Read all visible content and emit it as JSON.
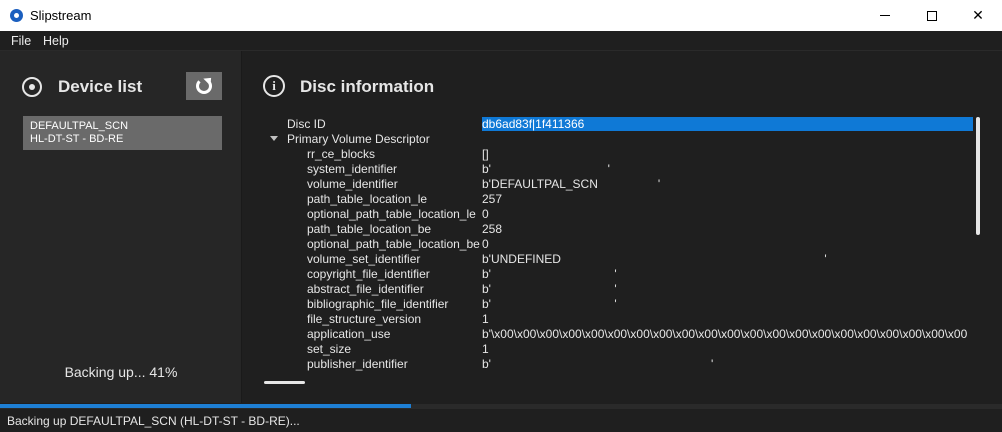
{
  "window": {
    "title": "Slipstream",
    "minimize_symbol": "",
    "maximize_symbol": "",
    "close_symbol": "✕"
  },
  "menu": {
    "items": [
      "File",
      "Help"
    ]
  },
  "device_panel": {
    "title": "Device list",
    "icon": "disc-icon",
    "refresh_icon": "refresh-icon",
    "devices": [
      {
        "name": "DEFAULTPAL_SCN",
        "drive": "HL-DT-ST - BD-RE"
      }
    ],
    "status": "Backing up... 41%"
  },
  "disc_panel": {
    "title": "Disc information",
    "icon": "info-icon",
    "rows": [
      {
        "key": "Disc ID",
        "value": "db6ad83f|1f411366",
        "indent": 0,
        "selected": true
      },
      {
        "key": "Primary Volume Descriptor",
        "value": "",
        "indent": 0,
        "expanded": true
      },
      {
        "key": "rr_ce_blocks",
        "value": "[]",
        "indent": 1
      },
      {
        "key": "system_identifier",
        "value": "b'                                   '",
        "indent": 1
      },
      {
        "key": "volume_identifier",
        "value": "b'DEFAULTPAL_SCN                  '",
        "indent": 1
      },
      {
        "key": "path_table_location_le",
        "value": "257",
        "indent": 1
      },
      {
        "key": "optional_path_table_location_le",
        "value": "0",
        "indent": 1
      },
      {
        "key": "path_table_location_be",
        "value": "258",
        "indent": 1
      },
      {
        "key": "optional_path_table_location_be",
        "value": "0",
        "indent": 1
      },
      {
        "key": "volume_set_identifier",
        "value": "b'UNDEFINED                                                                               '",
        "indent": 1
      },
      {
        "key": "copyright_file_identifier",
        "value": "b'                                     '",
        "indent": 1
      },
      {
        "key": "abstract_file_identifier",
        "value": "b'                                     '",
        "indent": 1
      },
      {
        "key": "bibliographic_file_identifier",
        "value": "b'                                     '",
        "indent": 1
      },
      {
        "key": "file_structure_version",
        "value": "1",
        "indent": 1
      },
      {
        "key": "application_use",
        "value": "b'\\x00\\x00\\x00\\x00\\x00\\x00\\x00\\x00\\x00\\x00\\x00\\x00\\x00\\x00\\x00\\x00\\x00\\x00\\x00\\x00\\x00",
        "indent": 1
      },
      {
        "key": "set_size",
        "value": "1",
        "indent": 1
      },
      {
        "key": "publisher_identifier",
        "value": "b'                                                                  '",
        "indent": 1
      }
    ]
  },
  "progress": {
    "fraction": 0.41
  },
  "statusbar": {
    "text": "Backing up DEFAULTPAL_SCN (HL-DT-ST - BD-RE)..."
  },
  "colors": {
    "accent": "#0f79d6",
    "progress": "#1e7fd4",
    "background": "#1f1f1f",
    "panel": "#262626"
  }
}
